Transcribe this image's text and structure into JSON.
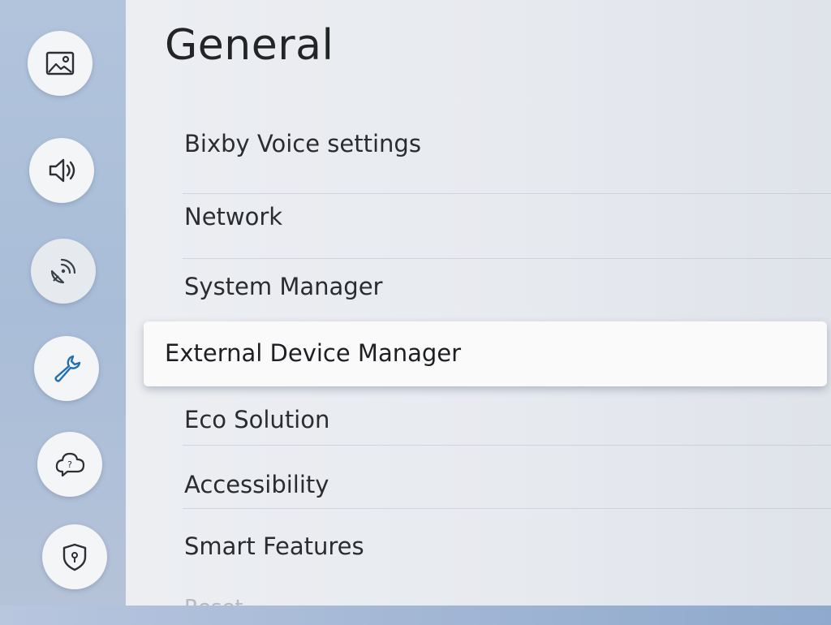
{
  "sidebar": {
    "items": [
      {
        "icon": "picture-icon",
        "active": false
      },
      {
        "icon": "sound-icon",
        "active": false
      },
      {
        "icon": "broadcasting-icon",
        "active": false
      },
      {
        "icon": "wrench-icon",
        "active": true
      },
      {
        "icon": "support-icon",
        "active": false
      },
      {
        "icon": "privacy-shield-icon",
        "active": false
      }
    ]
  },
  "panel": {
    "title": "General",
    "items": [
      {
        "label": "Bixby Voice settings"
      },
      {
        "label": "Network"
      },
      {
        "label": "System Manager"
      },
      {
        "label": "External Device Manager",
        "selected": true
      },
      {
        "label": "Eco Solution"
      },
      {
        "label": "Accessibility"
      },
      {
        "label": "Smart Features"
      },
      {
        "label": "Reset"
      }
    ]
  },
  "colors": {
    "accent": "#1f6fb2",
    "rail": "#aebfd8",
    "panel": "#e9ecf0",
    "text": "#2a2c2f"
  }
}
